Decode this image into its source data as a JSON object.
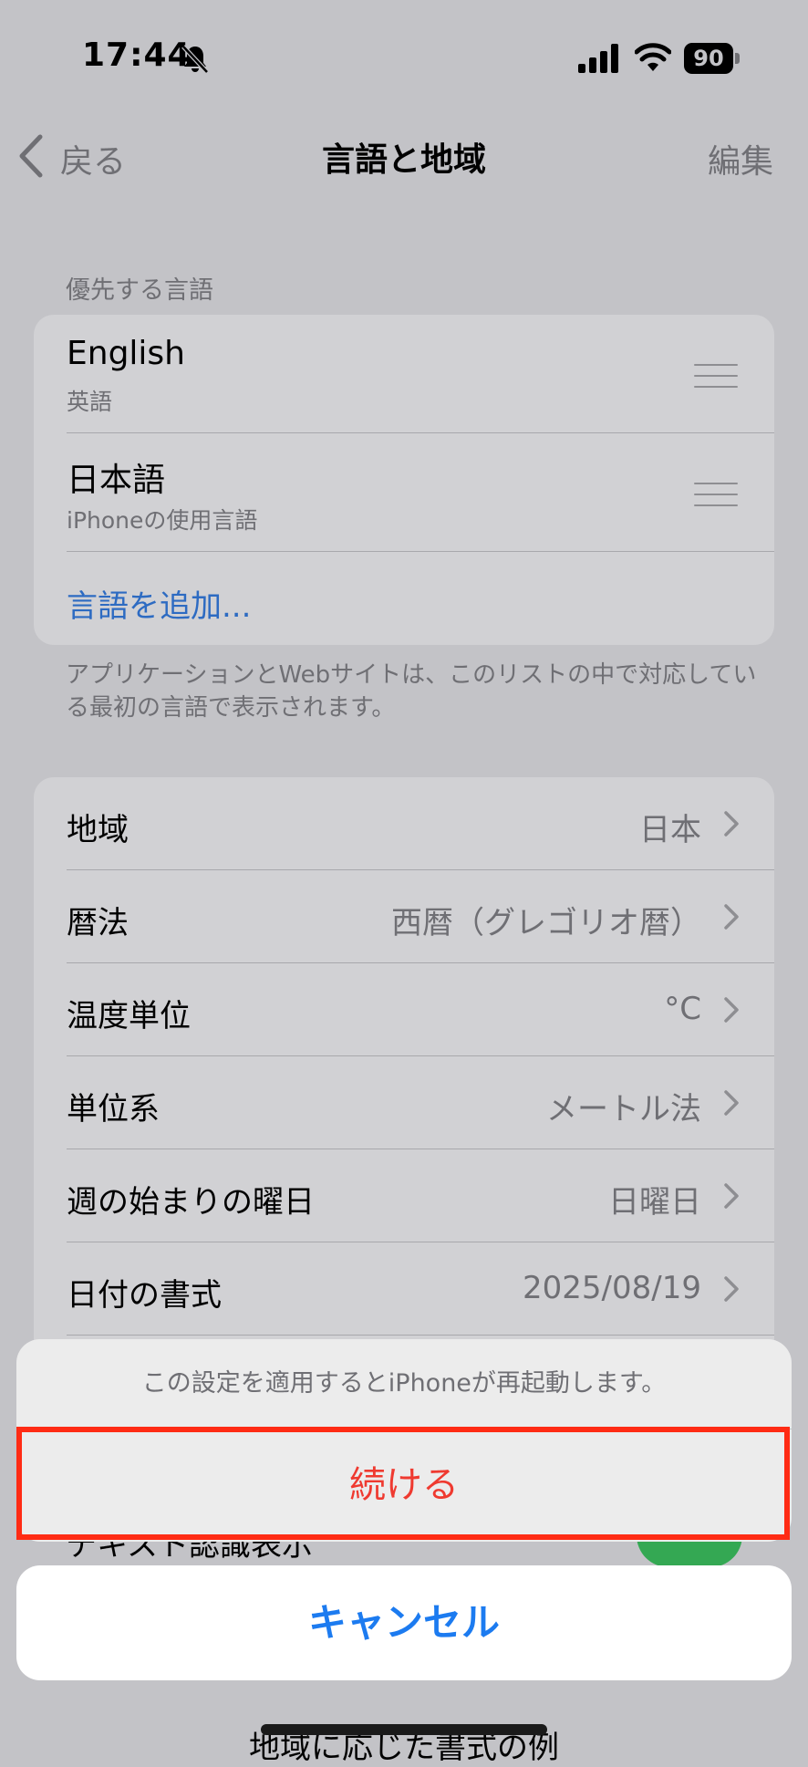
{
  "status_bar": {
    "time": "17:44",
    "battery": "90",
    "icons": [
      "bell-slash-icon",
      "cellular-signal-icon",
      "wifi-icon",
      "battery-icon"
    ]
  },
  "nav": {
    "back": "戻る",
    "title": "言語と地域",
    "edit": "編集"
  },
  "preferred": {
    "header": "優先する言語",
    "languages": [
      {
        "name": "English",
        "sub": "英語"
      },
      {
        "name": "日本語",
        "sub": "iPhoneの使用言語"
      }
    ],
    "add": "言語を追加...",
    "note": "アプリケーションとWebサイトは、このリストの中で対応している最初の言語で表示されます。"
  },
  "settings": [
    {
      "label": "地域",
      "value": "日本"
    },
    {
      "label": "暦法",
      "value": "西暦（グレゴリオ暦）"
    },
    {
      "label": "温度単位",
      "value": "°C"
    },
    {
      "label": "単位系",
      "value": "メートル法"
    },
    {
      "label": "週の始まりの曜日",
      "value": "日曜日"
    },
    {
      "label": "日付の書式",
      "value": "2025/08/19"
    }
  ],
  "obscured": {
    "row_label": "テキスト認識表示",
    "bottom_text": "地域に応じた書式の例"
  },
  "action_sheet": {
    "message": "この設定を適用するとiPhoneが再起動します。",
    "continue": "続ける",
    "cancel": "キャンセル"
  },
  "colors": {
    "link": "#2d6bc2",
    "destructive": "#ef3a30",
    "cancel": "#1c7bf0",
    "highlight": "#ff2b14",
    "toggle_on": "#34a853"
  }
}
